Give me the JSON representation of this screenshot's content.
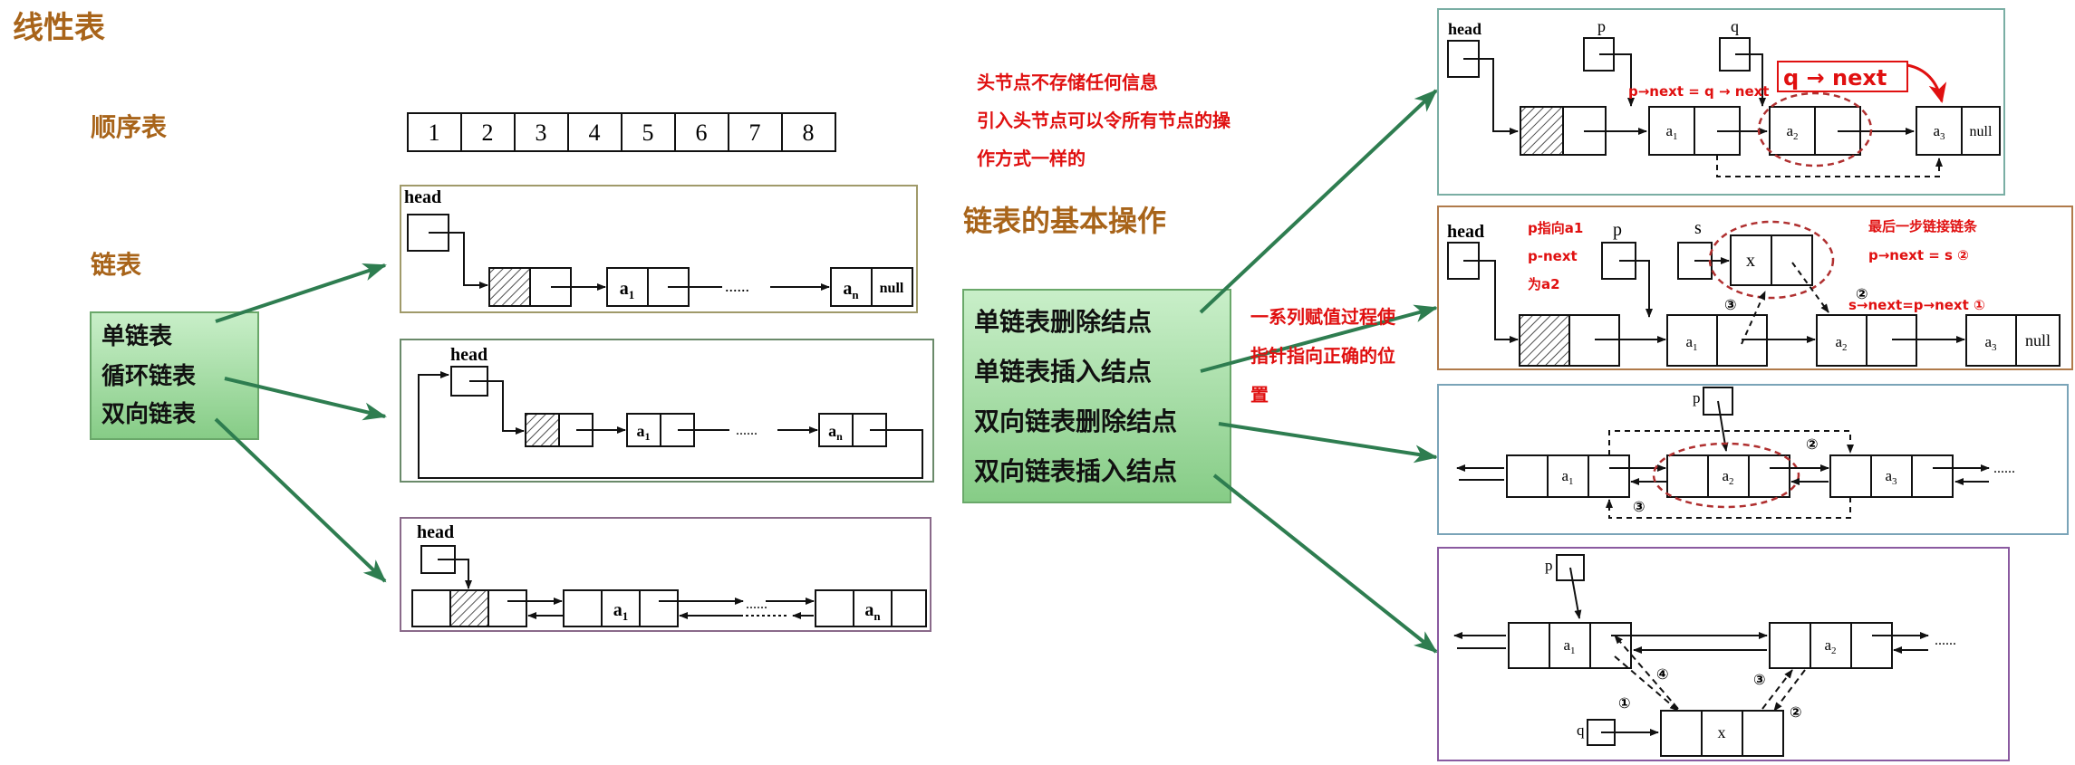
{
  "left": {
    "title": "线性表",
    "seq_label": "顺序表",
    "seq_cells": [
      "1",
      "2",
      "3",
      "4",
      "5",
      "6",
      "7",
      "8"
    ],
    "list_label": "链表",
    "types": [
      "单链表",
      "循环链表",
      "双向链表"
    ],
    "singly": {
      "head": "head",
      "first": "a",
      "first_sub": "1",
      "dots": "......",
      "last": "a",
      "last_sub": "n",
      "null": "null"
    },
    "circular": {
      "head": "head",
      "first": "a",
      "first_sub": "1",
      "dots": "......",
      "last": "a",
      "last_sub": "n"
    },
    "doubly": {
      "head": "head",
      "first": "a",
      "first_sub": "1",
      "dots": "......",
      "last": "a",
      "last_sub": "n"
    }
  },
  "middle": {
    "note_lines": [
      "头节点不存储任何信息",
      "引入头节点可以令所有节点的操",
      "作方式一样的"
    ],
    "ops_title": "链表的基本操作",
    "ops": [
      "单链表删除结点",
      "单链表插入结点",
      "双向链表删除结点",
      "双向链表插入结点"
    ],
    "assign_note_lines": [
      "一系列赋值过程使",
      "指针指向正确的位",
      "置"
    ]
  },
  "right": {
    "del": {
      "head": "head",
      "p": "p",
      "q": "q",
      "n1": "a",
      "n1_sub": "1",
      "n2": "a",
      "n2_sub": "2",
      "n3": "a",
      "n3_sub": "3",
      "null": "null",
      "ann_small": "p→next = q → next",
      "ann_big": "q → next"
    },
    "ins": {
      "head": "head",
      "p": "p",
      "s": "s",
      "x": "x",
      "n1": "a",
      "n1_sub": "1",
      "n2": "a",
      "n2_sub": "2",
      "n3": "a",
      "n3_sub": "3",
      "null": "null",
      "ann_p_lines": [
        "p指向a1",
        "p-next",
        "为a2"
      ],
      "ann_last_lines": [
        "最后一步链接链条",
        "p→next = s  ②"
      ],
      "ann_snext": "s→next=p→next ①",
      "c2": "②",
      "c3": "③"
    },
    "ddel": {
      "p": "p",
      "n1": "a",
      "n1_sub": "1",
      "n2": "a",
      "n2_sub": "2",
      "n3": "a",
      "n3_sub": "3",
      "dots": "......",
      "c2": "②",
      "c3": "③"
    },
    "dins": {
      "p": "p",
      "q": "q",
      "x": "x",
      "n1": "a",
      "n1_sub": "1",
      "n2": "a",
      "n2_sub": "2",
      "dots": "......",
      "c1": "①",
      "c2": "②",
      "c3": "③",
      "c4": "④"
    }
  },
  "colors": {
    "title_brown": "#a8641a",
    "red_note": "#e01010",
    "green_box": "#9fd99f",
    "arrow_green": "#2e7d50"
  }
}
